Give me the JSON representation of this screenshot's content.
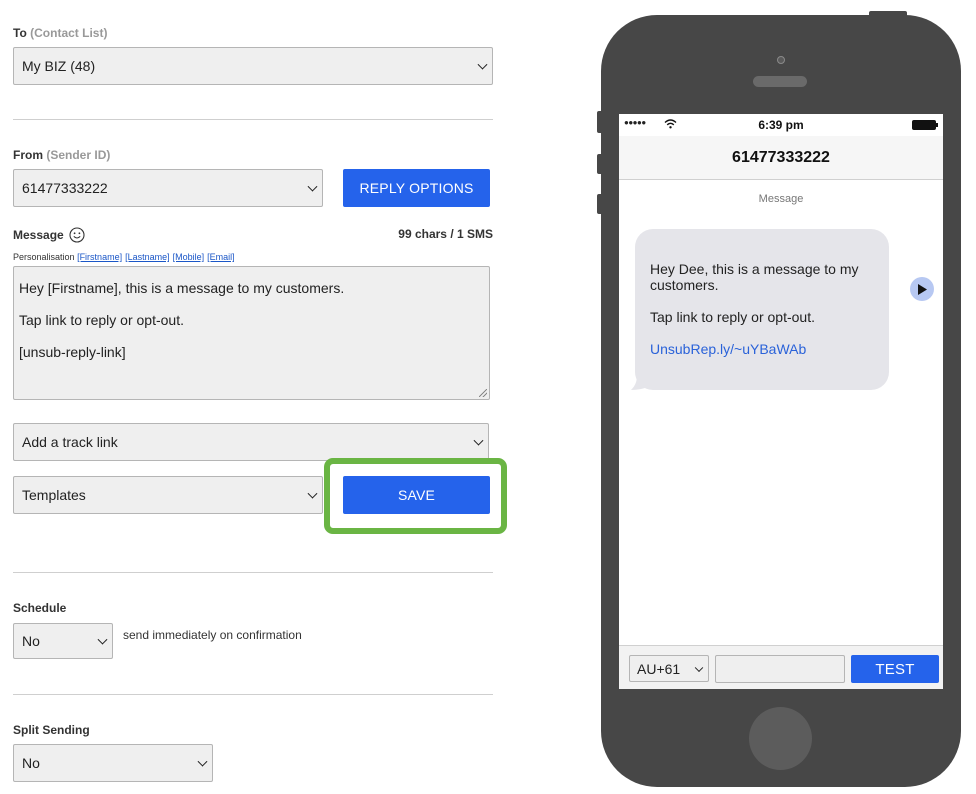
{
  "form": {
    "to_label": "To",
    "to_sub": "(Contact List)",
    "to_value": "My BIZ (48)",
    "from_label": "From",
    "from_sub": "(Sender ID)",
    "from_value": "61477333222",
    "reply_options_label": "REPLY OPTIONS",
    "message_label": "Message",
    "char_count": "99 chars / 1 SMS",
    "personalisation_label": "Personalisation",
    "personalisation_tags": [
      "[Firstname]",
      "[Lastname]",
      "[Mobile]",
      "[Email]"
    ],
    "message_lines": [
      "Hey [Firstname], this is a message to my customers.",
      "Tap link to reply or opt-out.",
      "[unsub-reply-link]"
    ],
    "track_link_value": "Add a track link",
    "templates_value": "Templates",
    "save_label": "SAVE",
    "schedule_label": "Schedule",
    "schedule_value": "No",
    "schedule_hint": "send immediately on confirmation",
    "split_label": "Split Sending",
    "split_value": "No"
  },
  "phone": {
    "signal": "●●●●●",
    "time": "6:39 pm",
    "contact": "61477333222",
    "thread_label": "Message",
    "bubble_lines": [
      "Hey Dee, this is a message to my customers.",
      "Tap link to reply or opt-out."
    ],
    "bubble_link": "UnsubRep.ly/~uYBaWAb",
    "country_code": "AU+61",
    "number_input_value": "",
    "test_label": "TEST"
  },
  "colors": {
    "accent": "#2563eb",
    "highlight": "#6ab544",
    "phone_body": "#474747"
  },
  "icons": [
    "smiley-icon",
    "wifi-icon",
    "battery-icon",
    "play-icon",
    "chevron-down-icon"
  ]
}
